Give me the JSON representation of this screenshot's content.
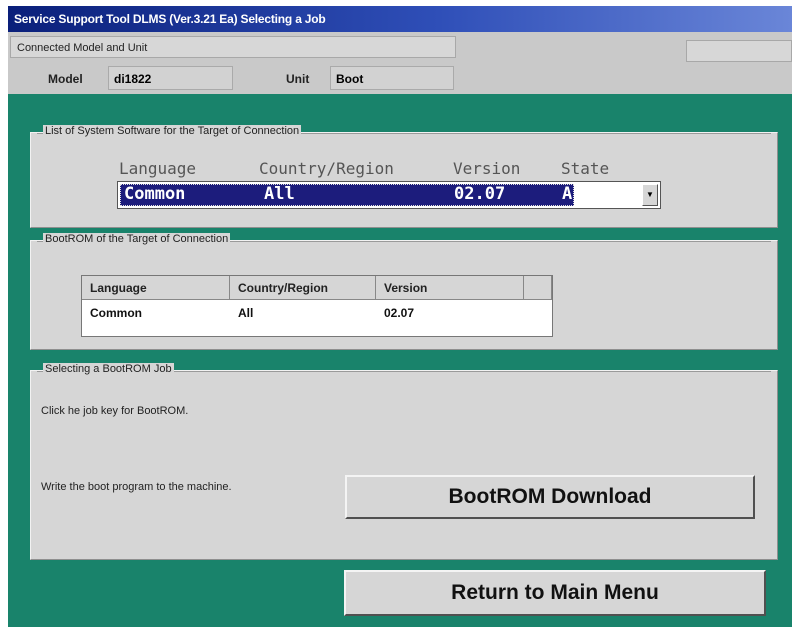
{
  "window": {
    "title": "Service Support Tool DLMS (Ver.3.21 Ea) Selecting a Job"
  },
  "info": {
    "connected_label": "Connected Model and Unit",
    "model_label": "Model",
    "model_value": "di1822",
    "unit_label": "Unit",
    "unit_value": "Boot"
  },
  "system_software": {
    "legend": "List of System Software for the Target of Connection",
    "headers": {
      "language": "Language",
      "country": "Country/Region",
      "version": "Version",
      "state": "State"
    },
    "selected": {
      "language": "Common",
      "country": "All",
      "version": "02.07",
      "state": "A"
    }
  },
  "bootrom": {
    "legend": "BootROM of the Target of Connection",
    "columns": [
      "Language",
      "Country/Region",
      "Version"
    ],
    "rows": [
      {
        "language": "Common",
        "country": "All",
        "version": "02.07"
      }
    ]
  },
  "job": {
    "legend": "Selecting a BootROM Job",
    "instruction": "Click he job key for BootROM.",
    "write_desc": "Write the boot program to the machine.",
    "download_button": "BootROM Download"
  },
  "footer": {
    "return_button": "Return to Main Menu"
  },
  "colors": {
    "title_bar": "#0a1f7a",
    "background": "#19836b",
    "selection": "#1c1c7c"
  }
}
